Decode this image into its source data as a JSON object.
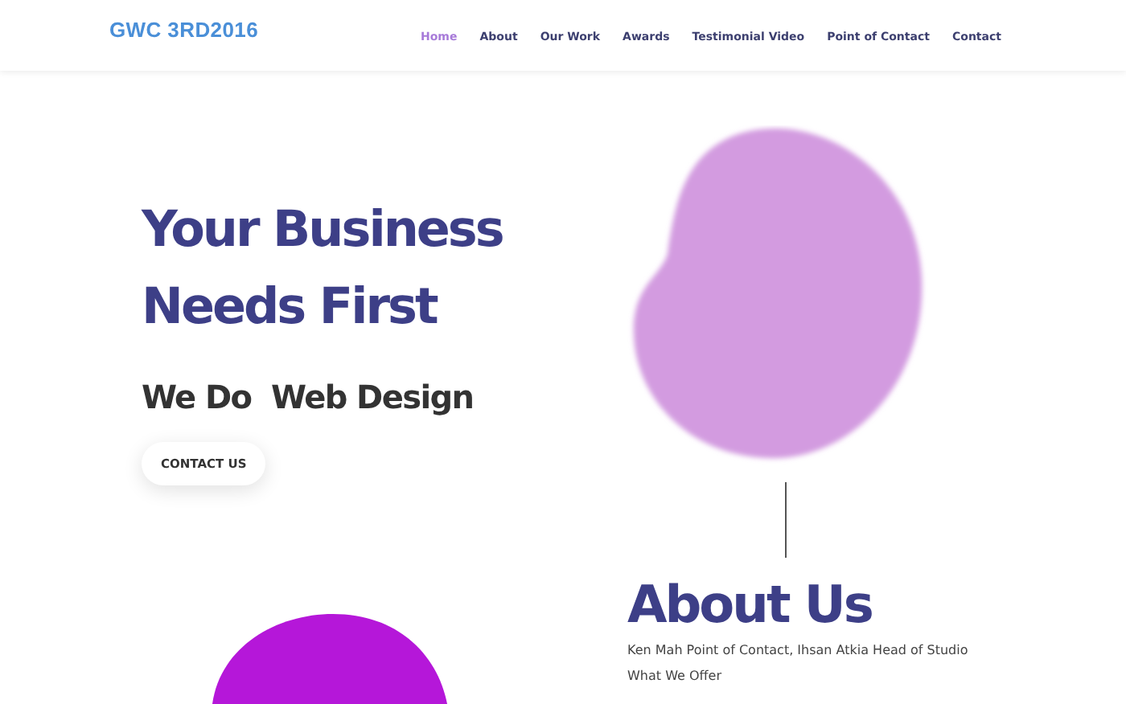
{
  "navbar": {
    "brand": "GWC 3RD2016",
    "items": [
      {
        "label": "Home",
        "selected": true
      },
      {
        "label": "About",
        "selected": false
      },
      {
        "label": "Our Work",
        "selected": false
      },
      {
        "label": "Awards",
        "selected": false
      },
      {
        "label": "Testimonial Video",
        "selected": false
      },
      {
        "label": "Point of Contact",
        "selected": false
      },
      {
        "label": "Contact",
        "selected": false
      }
    ]
  },
  "hero": {
    "title_lines": [
      "Your Business",
      "Needs First"
    ],
    "subtitle": "We Do  Web Design",
    "button": "CONTACT US"
  },
  "about": {
    "title": "About Us",
    "text": "Ken Mah Point of Contact, Ihsan Atkia Head of Studio",
    "next_heading": "What We Offer"
  }
}
